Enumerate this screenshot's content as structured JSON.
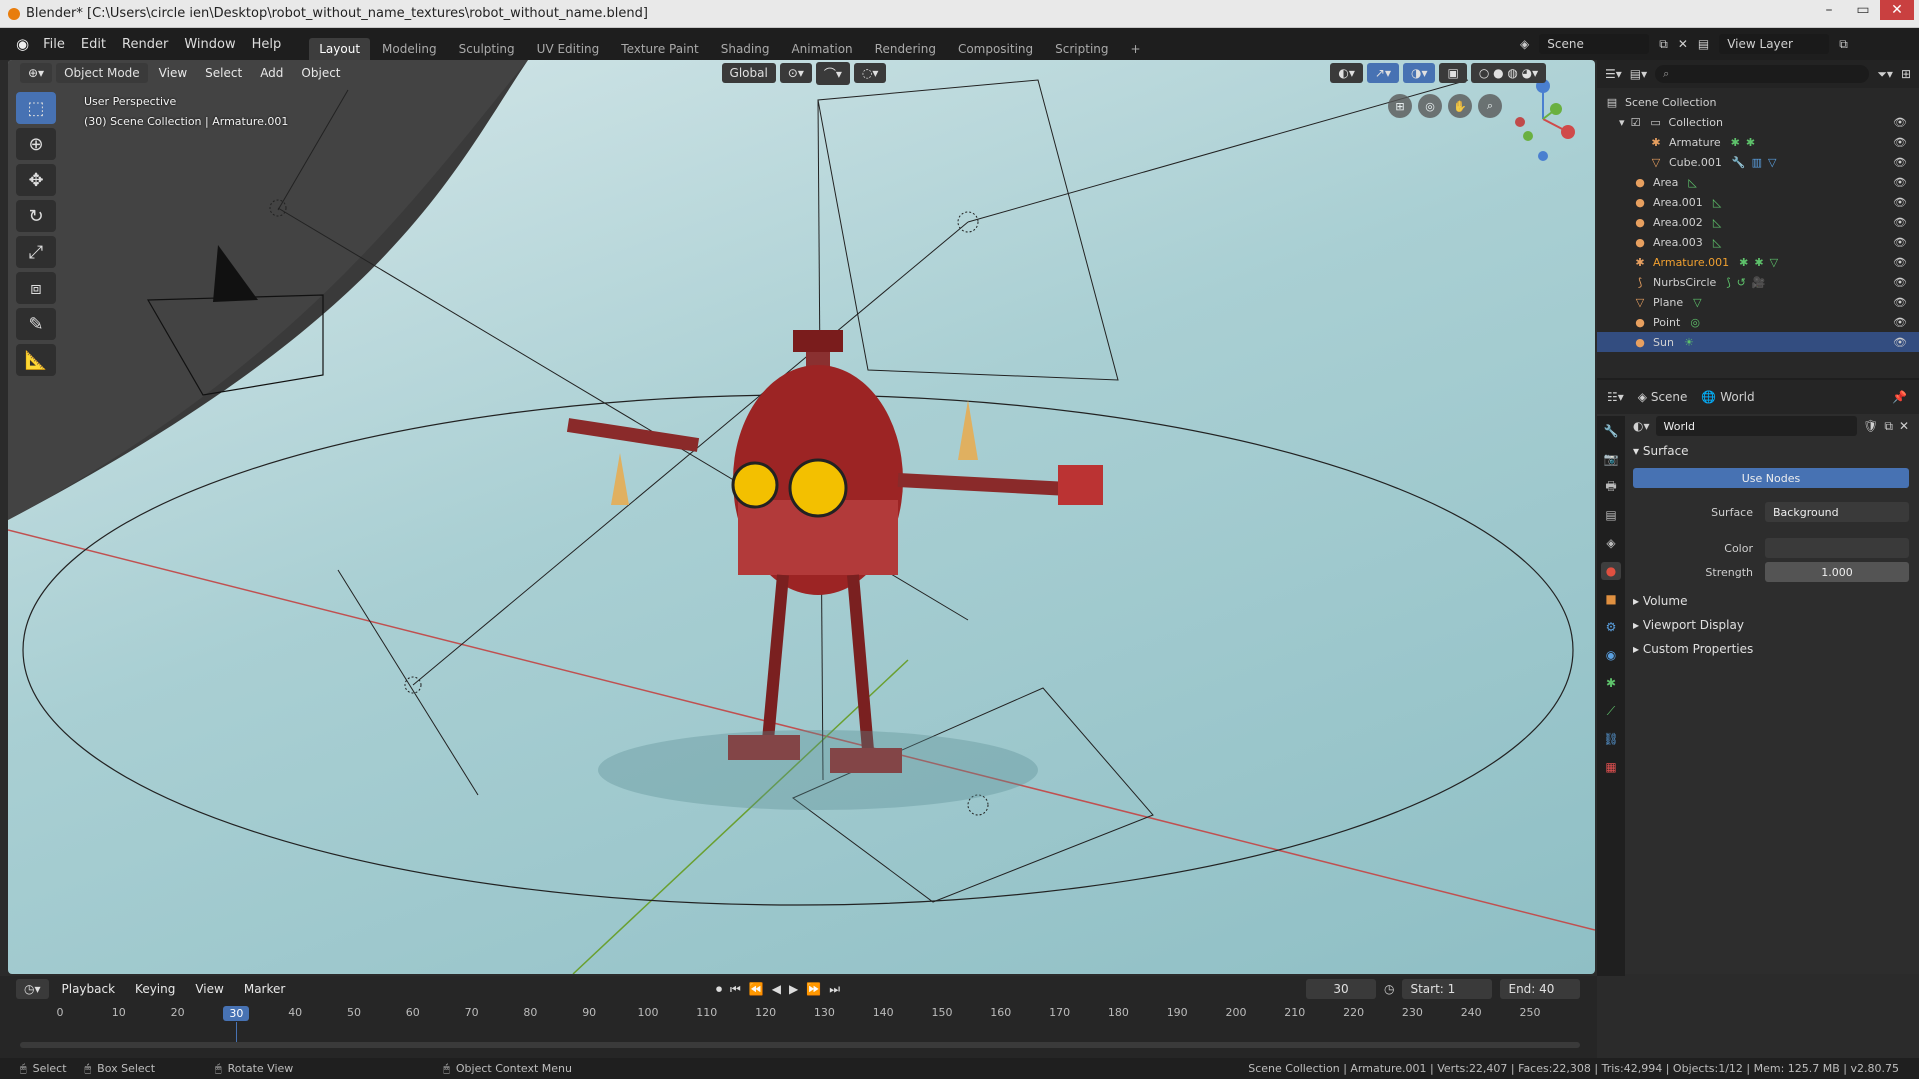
{
  "window": {
    "title": "Blender* [C:\\Users\\circle ien\\Desktop\\robot_without_name_textures\\robot_without_name.blend]"
  },
  "menu": [
    "File",
    "Edit",
    "Render",
    "Window",
    "Help"
  ],
  "workspaces": [
    "Layout",
    "Modeling",
    "Sculpting",
    "UV Editing",
    "Texture Paint",
    "Shading",
    "Animation",
    "Rendering",
    "Compositing",
    "Scripting"
  ],
  "top_right": {
    "scene": "Scene",
    "view_layer": "View Layer"
  },
  "viewport": {
    "mode": "Object Mode",
    "menus": [
      "View",
      "Select",
      "Add",
      "Object"
    ],
    "transform": "Global",
    "info_line1": "User Perspective",
    "info_line2": "(30) Scene Collection | Armature.001"
  },
  "outliner": {
    "root": "Scene Collection",
    "collection": "Collection",
    "items": [
      {
        "name": "Armature",
        "indent": 2
      },
      {
        "name": "Cube.001",
        "indent": 2
      },
      {
        "name": "Area",
        "indent": 1
      },
      {
        "name": "Area.001",
        "indent": 1
      },
      {
        "name": "Area.002",
        "indent": 1
      },
      {
        "name": "Area.003",
        "indent": 1
      },
      {
        "name": "Armature.001",
        "indent": 1
      },
      {
        "name": "NurbsCircle",
        "indent": 1
      },
      {
        "name": "Plane",
        "indent": 1
      },
      {
        "name": "Point",
        "indent": 1
      },
      {
        "name": "Sun",
        "indent": 1
      }
    ]
  },
  "properties": {
    "scene_tab": "Scene",
    "world_tab": "World",
    "world_name": "World",
    "surface_section": "Surface",
    "use_nodes": "Use Nodes",
    "surface_label": "Surface",
    "surface_value": "Background",
    "color_label": "Color",
    "strength_label": "Strength",
    "strength_value": "1.000",
    "volume": "Volume",
    "viewport_display": "Viewport Display",
    "custom_properties": "Custom Properties"
  },
  "timeline": {
    "menus": [
      "Playback",
      "Keying",
      "View",
      "Marker"
    ],
    "current_frame": "30",
    "start_label": "Start:",
    "start_value": "1",
    "end_label": "End:",
    "end_value": "40",
    "ticks": [
      0,
      10,
      20,
      30,
      40,
      50,
      60,
      70,
      80,
      90,
      100,
      110,
      120,
      130,
      140,
      150,
      160,
      170,
      180,
      190,
      200,
      210,
      220,
      230,
      240,
      250
    ]
  },
  "statusbar": {
    "select": "Select",
    "box_select": "Box Select",
    "rotate_view": "Rotate View",
    "context_menu": "Object Context Menu",
    "stats": "Scene Collection | Armature.001 | Verts:22,407 | Faces:22,308 | Tris:42,994 | Objects:1/12 | Mem: 125.7 MB | v2.80.75"
  }
}
